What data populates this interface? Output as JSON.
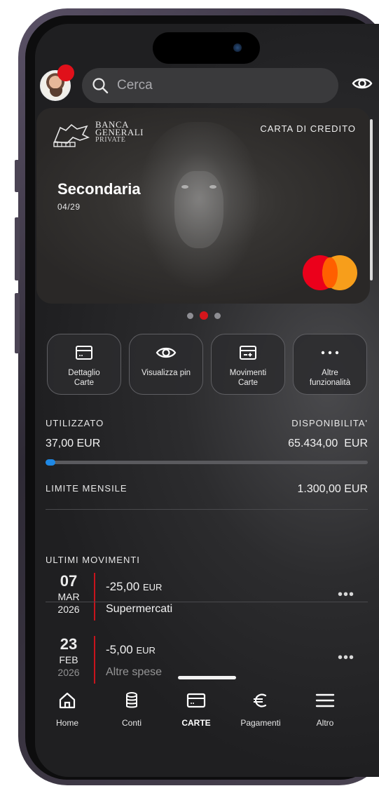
{
  "search": {
    "placeholder": "Cerca"
  },
  "card": {
    "bank_line1": "BANCA",
    "bank_line2": "GENERALI",
    "bank_line3": "PRIVATE",
    "type": "CARTA DI CREDITO",
    "name": "Secondaria",
    "expiry": "04/29",
    "carousel_active_index": 1,
    "carousel_count": 3
  },
  "actions": [
    {
      "label": "Dettaglio\nCarte",
      "icon": "card-detail-icon"
    },
    {
      "label": "Visualizza pin",
      "icon": "eye-icon"
    },
    {
      "label": "Movimenti\nCarte",
      "icon": "card-transactions-icon"
    },
    {
      "label": "Altre\nfunzionalità",
      "icon": "more-dots-icon"
    }
  ],
  "stats": {
    "used_label": "UTILIZZATO",
    "available_label": "DISPONIBILITA'",
    "used_value": "37,00 EUR",
    "available_value": "65.434,00  EUR",
    "monthly_limit_label": "LIMITE MENSILE",
    "monthly_limit_value": "1.300,00 EUR",
    "used_fraction": 0.03
  },
  "movements": {
    "title": "ULTIMI MOVIMENTI",
    "items": [
      {
        "day": "07",
        "month": "MAR",
        "year": "2026",
        "amount": "-25,00",
        "currency": "EUR",
        "description": "Supermercati"
      },
      {
        "day": "23",
        "month": "FEB",
        "year": "2026",
        "amount": "-5,00",
        "currency": "EUR",
        "description": "Altre spese"
      }
    ]
  },
  "tabbar": [
    {
      "label": "Home",
      "icon": "home-icon"
    },
    {
      "label": "Conti",
      "icon": "coins-icon"
    },
    {
      "label": "CARTE",
      "icon": "card-icon",
      "active": true
    },
    {
      "label": "Pagamenti",
      "icon": "euro-icon"
    },
    {
      "label": "Altro",
      "icon": "menu-icon"
    }
  ],
  "colors": {
    "accent_red": "#d4161c",
    "progress_blue": "#1e88e5",
    "mastercard_red": "#eb001b",
    "mastercard_yellow": "#f79e1b"
  }
}
